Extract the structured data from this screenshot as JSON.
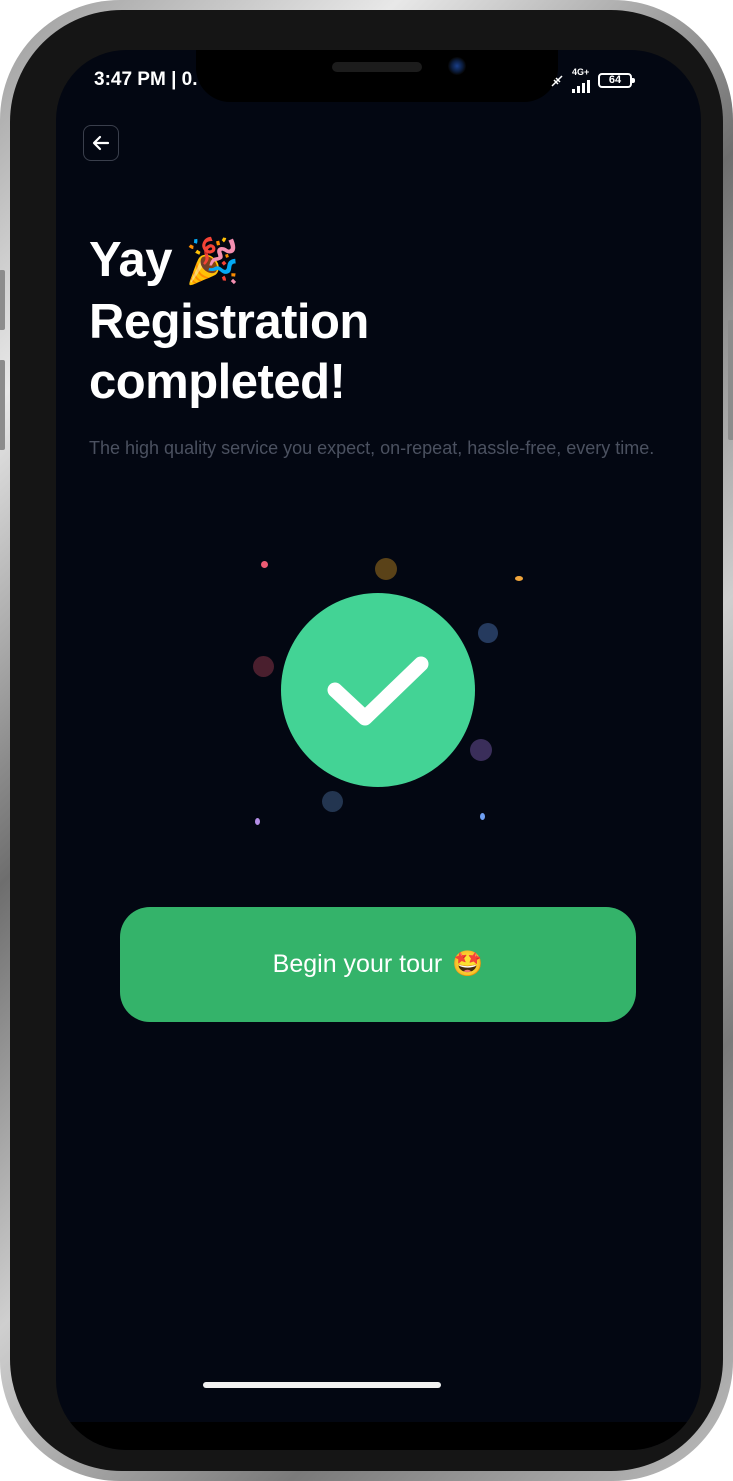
{
  "status_bar": {
    "time": "3:47 PM | 0.",
    "network": "4G+",
    "battery": "64"
  },
  "header": {
    "title_line1": "Yay",
    "title_emoji": "🎉",
    "title_line2": "Registration",
    "title_line3": "completed!",
    "subtitle": "The high quality service you expect, on-repeat, hassle-free, every time."
  },
  "cta": {
    "label": "Begin your tour",
    "emoji": "🤩"
  },
  "icons": {
    "back": "arrow-left-icon",
    "check": "checkmark-icon"
  },
  "colors": {
    "background": "#030712",
    "accent": "#43d395",
    "button": "#34b36a",
    "subtitle": "#4b5160"
  }
}
